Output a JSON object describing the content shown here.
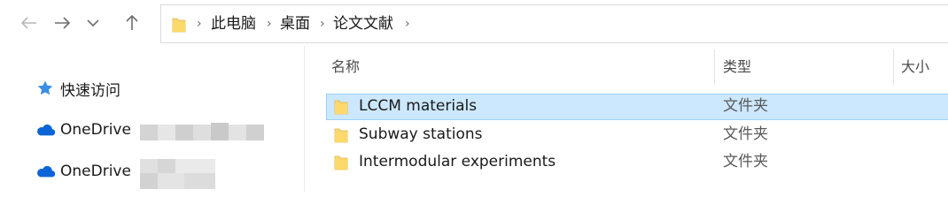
{
  "nav": {
    "back_icon": "arrow-left-icon",
    "forward_icon": "arrow-right-icon",
    "recent_icon": "chevron-down-icon",
    "up_icon": "arrow-up-icon"
  },
  "address": {
    "folder_icon": "folder-icon",
    "crumbs": [
      "此电脑",
      "桌面",
      "论文文献"
    ]
  },
  "sidebar": {
    "items": [
      {
        "label": "快速访问",
        "icon": "star-pin-icon"
      },
      {
        "label": "OneDrive",
        "icon": "cloud-icon"
      },
      {
        "label": "OneDrive",
        "icon": "cloud-icon"
      }
    ]
  },
  "columns": {
    "name": "名称",
    "type": "类型",
    "size": "大小"
  },
  "files": [
    {
      "name": "LCCM materials",
      "type": "文件夹",
      "selected": true
    },
    {
      "name": "Subway stations",
      "type": "文件夹",
      "selected": false
    },
    {
      "name": "Intermodular experiments",
      "type": "文件夹",
      "selected": false
    }
  ],
  "colors": {
    "selection_bg": "#cce8ff",
    "selection_border": "#99d1ff",
    "folder_yellow": "#f8d775",
    "onedrive_blue": "#0a64d8"
  }
}
